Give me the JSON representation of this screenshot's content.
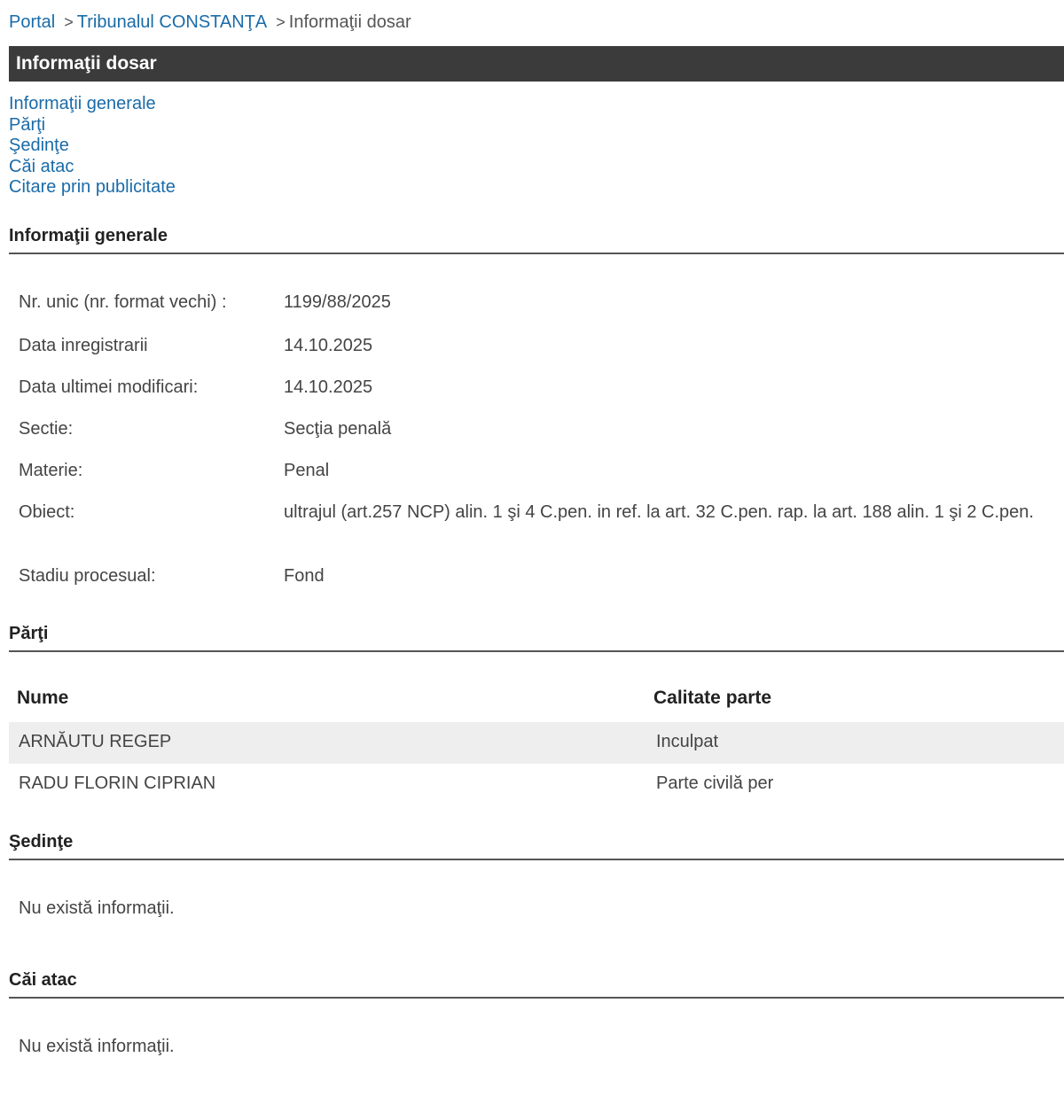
{
  "breadcrumb": {
    "items": [
      "Portal",
      "Tribunalul CONSTANŢA"
    ],
    "separator": ">",
    "current": "Informaţii dosar"
  },
  "title": "Informaţii dosar",
  "quick_nav": [
    "Informaţii generale",
    "Părţi",
    "Şedinţe",
    "Căi atac",
    "Citare prin publicitate"
  ],
  "general": {
    "heading": "Informaţii generale",
    "rows": [
      {
        "label": "Nr. unic (nr. format vechi) :",
        "value": "1199/88/2025"
      },
      {
        "label": "Data inregistrarii",
        "value": "14.10.2025"
      },
      {
        "label": "Data ultimei modificari:",
        "value": "14.10.2025"
      },
      {
        "label": "Sectie:",
        "value": "Secţia penală"
      },
      {
        "label": "Materie:",
        "value": "Penal"
      },
      {
        "label": "Obiect:",
        "value": "ultrajul (art.257 NCP) alin. 1 şi 4 C.pen. in ref. la art. 32 C.pen. rap. la art. 188 alin. 1 şi 2 C.pen."
      },
      {
        "label": "Stadiu procesual:",
        "value": "Fond"
      }
    ]
  },
  "parties": {
    "heading": "Părţi",
    "columns": [
      "Nume",
      "Calitate parte"
    ],
    "rows": [
      {
        "name": "ARNĂUTU REGEP",
        "role": "Inculpat"
      },
      {
        "name": "RADU FLORIN CIPRIAN",
        "role": "Parte civilă per"
      }
    ]
  },
  "hearings": {
    "heading": "Şedinţe",
    "empty": "Nu există informaţii."
  },
  "appeals": {
    "heading": "Căi atac",
    "empty": "Nu există informaţii."
  },
  "colors": {
    "link": "#1a6ba8",
    "title_bar": "#3b3b3b",
    "row_alt": "#eeeeee"
  }
}
